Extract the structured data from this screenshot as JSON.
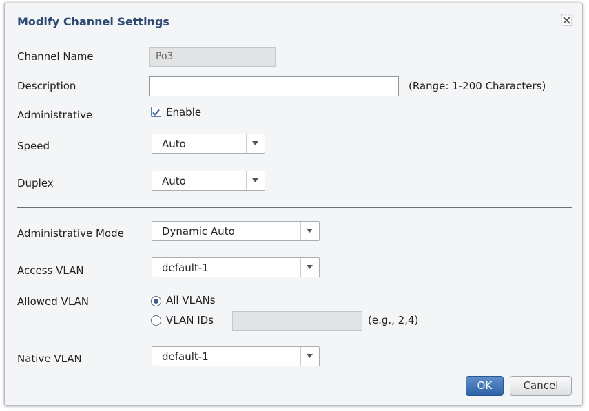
{
  "dialog": {
    "title": "Modify Channel Settings",
    "close_icon": "close-icon"
  },
  "channel_name": {
    "label": "Channel Name",
    "value": "Po3"
  },
  "description": {
    "label": "Description",
    "value": "",
    "hint": "(Range: 1-200 Characters)"
  },
  "administrative": {
    "label": "Administrative",
    "checkbox_label": "Enable",
    "checked": true
  },
  "speed": {
    "label": "Speed",
    "value": "Auto"
  },
  "duplex": {
    "label": "Duplex",
    "value": "Auto"
  },
  "admin_mode": {
    "label": "Administrative Mode",
    "value": "Dynamic Auto"
  },
  "access_vlan": {
    "label": "Access VLAN",
    "value": "default-1"
  },
  "allowed_vlan": {
    "label": "Allowed VLAN",
    "option_all": "All VLANs",
    "option_ids": "VLAN IDs",
    "selected": "all",
    "ids_value": "",
    "ids_hint": "(e.g., 2,4)"
  },
  "native_vlan": {
    "label": "Native VLAN",
    "value": "default-1"
  },
  "buttons": {
    "ok": "OK",
    "cancel": "Cancel"
  },
  "colors": {
    "title": "#2e4a74",
    "primary_button": "#3b6eb0"
  }
}
